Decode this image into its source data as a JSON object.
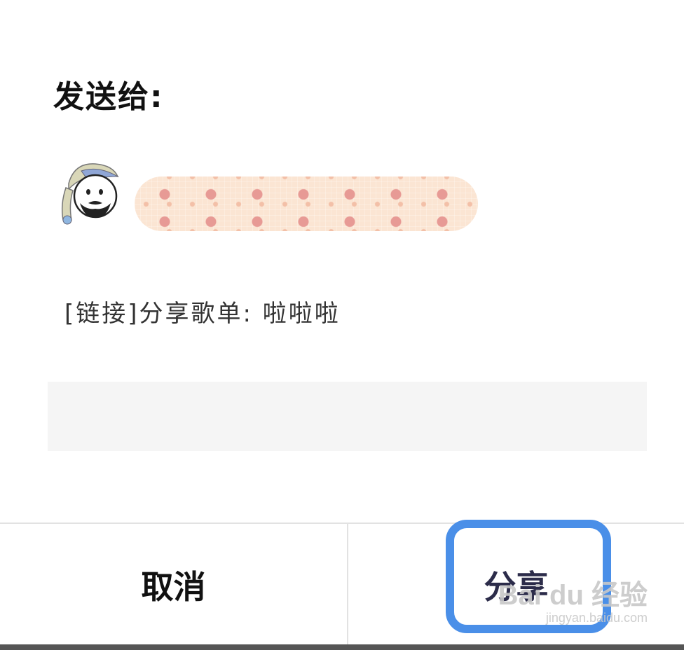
{
  "dialog": {
    "title": "发送给:",
    "recipient": {
      "avatar_icon": "cartoon-face-avatar",
      "name": ""
    },
    "message": "[链接]分享歌单: 啦啦啦",
    "input": {
      "value": "",
      "placeholder": ""
    },
    "buttons": {
      "cancel_label": "取消",
      "share_label": "分享"
    }
  },
  "colors": {
    "highlight": "#4a8fe8",
    "input_bg": "#f5f5f5",
    "pill_bg": "#fbe5d3"
  },
  "watermark": {
    "logo": "Bai du 经验",
    "url": "jingyan.baidu.com"
  }
}
